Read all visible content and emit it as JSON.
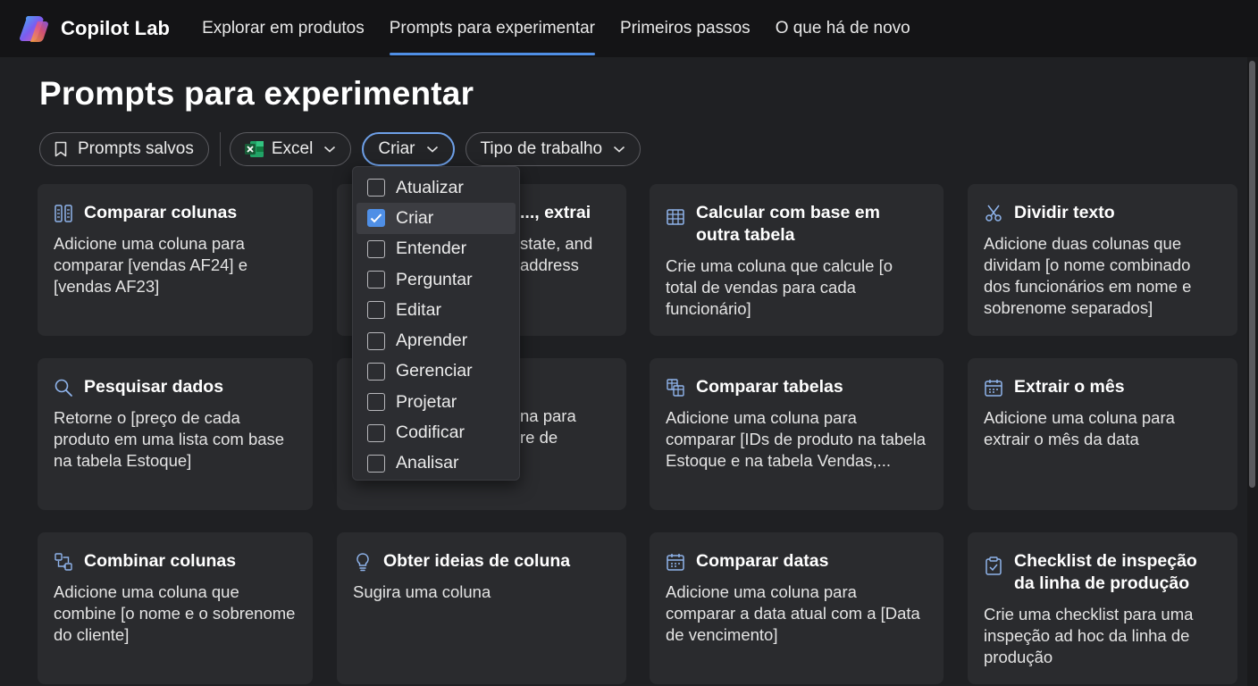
{
  "app": {
    "name": "Copilot Lab"
  },
  "nav": {
    "items": [
      {
        "label": "Explorar em produtos",
        "active": false
      },
      {
        "label": "Prompts para experimentar",
        "active": true
      },
      {
        "label": "Primeiros passos",
        "active": false
      },
      {
        "label": "O que há de novo",
        "active": false
      }
    ]
  },
  "page": {
    "title": "Prompts para experimentar"
  },
  "filters": {
    "saved": "Prompts salvos",
    "app": "Excel",
    "action": "Criar",
    "work_type": "Tipo de trabalho"
  },
  "dropdown": {
    "options": [
      {
        "label": "Atualizar",
        "checked": false
      },
      {
        "label": "Criar",
        "checked": true
      },
      {
        "label": "Entender",
        "checked": false
      },
      {
        "label": "Perguntar",
        "checked": false
      },
      {
        "label": "Editar",
        "checked": false
      },
      {
        "label": "Aprender",
        "checked": false
      },
      {
        "label": "Gerenciar",
        "checked": false
      },
      {
        "label": "Projetar",
        "checked": false
      },
      {
        "label": "Codificar",
        "checked": false
      },
      {
        "label": "Analisar",
        "checked": false
      }
    ]
  },
  "cards": [
    {
      "title": "Comparar colunas",
      "desc": "Adicione uma coluna para comparar [vendas AF24] e [vendas AF23]",
      "icon": "compare-columns-icon"
    },
    {
      "title": "..., extrai",
      "desc": "state, and address",
      "icon": ""
    },
    {
      "title": "Calcular com base em outra tabela",
      "desc": "Crie uma coluna que calcule [o total de vendas para cada funcionário]",
      "icon": "table-icon"
    },
    {
      "title": "Dividir texto",
      "desc": "Adicione duas colunas que dividam [o nome combinado dos funcionários em nome e sobrenome separados]",
      "icon": "scissors-icon"
    },
    {
      "title": "Pesquisar dados",
      "desc": "Retorne o [preço de cada produto em uma lista com base na tabela Estoque]",
      "icon": "search-icon"
    },
    {
      "title": "",
      "desc": "na para re de",
      "icon": ""
    },
    {
      "title": "Comparar tabelas",
      "desc": "Adicione uma coluna para comparar [IDs de produto na tabela Estoque e na tabela Vendas,...",
      "icon": "compare-tables-icon"
    },
    {
      "title": "Extrair o mês",
      "desc": "Adicione uma coluna para extrair o mês da data",
      "icon": "calendar-icon"
    },
    {
      "title": "Combinar colunas",
      "desc": "Adicione uma coluna que combine [o nome e o sobrenome do cliente]",
      "icon": "combine-icon"
    },
    {
      "title": "Obter ideias de coluna",
      "desc": "Sugira uma coluna",
      "icon": "lightbulb-icon"
    },
    {
      "title": "Comparar datas",
      "desc": "Adicione uma coluna para comparar a data atual com a [Data de vencimento]",
      "icon": "calendar-icon"
    },
    {
      "title": "Checklist de inspeção da linha de produção",
      "desc": "Crie uma checklist para uma inspeção ad hoc da linha de produção",
      "icon": "clipboard-icon"
    }
  ],
  "colors": {
    "accent": "#4f8fe6",
    "background": "#1f2023",
    "card": "#2a2b2e",
    "topbar": "#141416"
  }
}
